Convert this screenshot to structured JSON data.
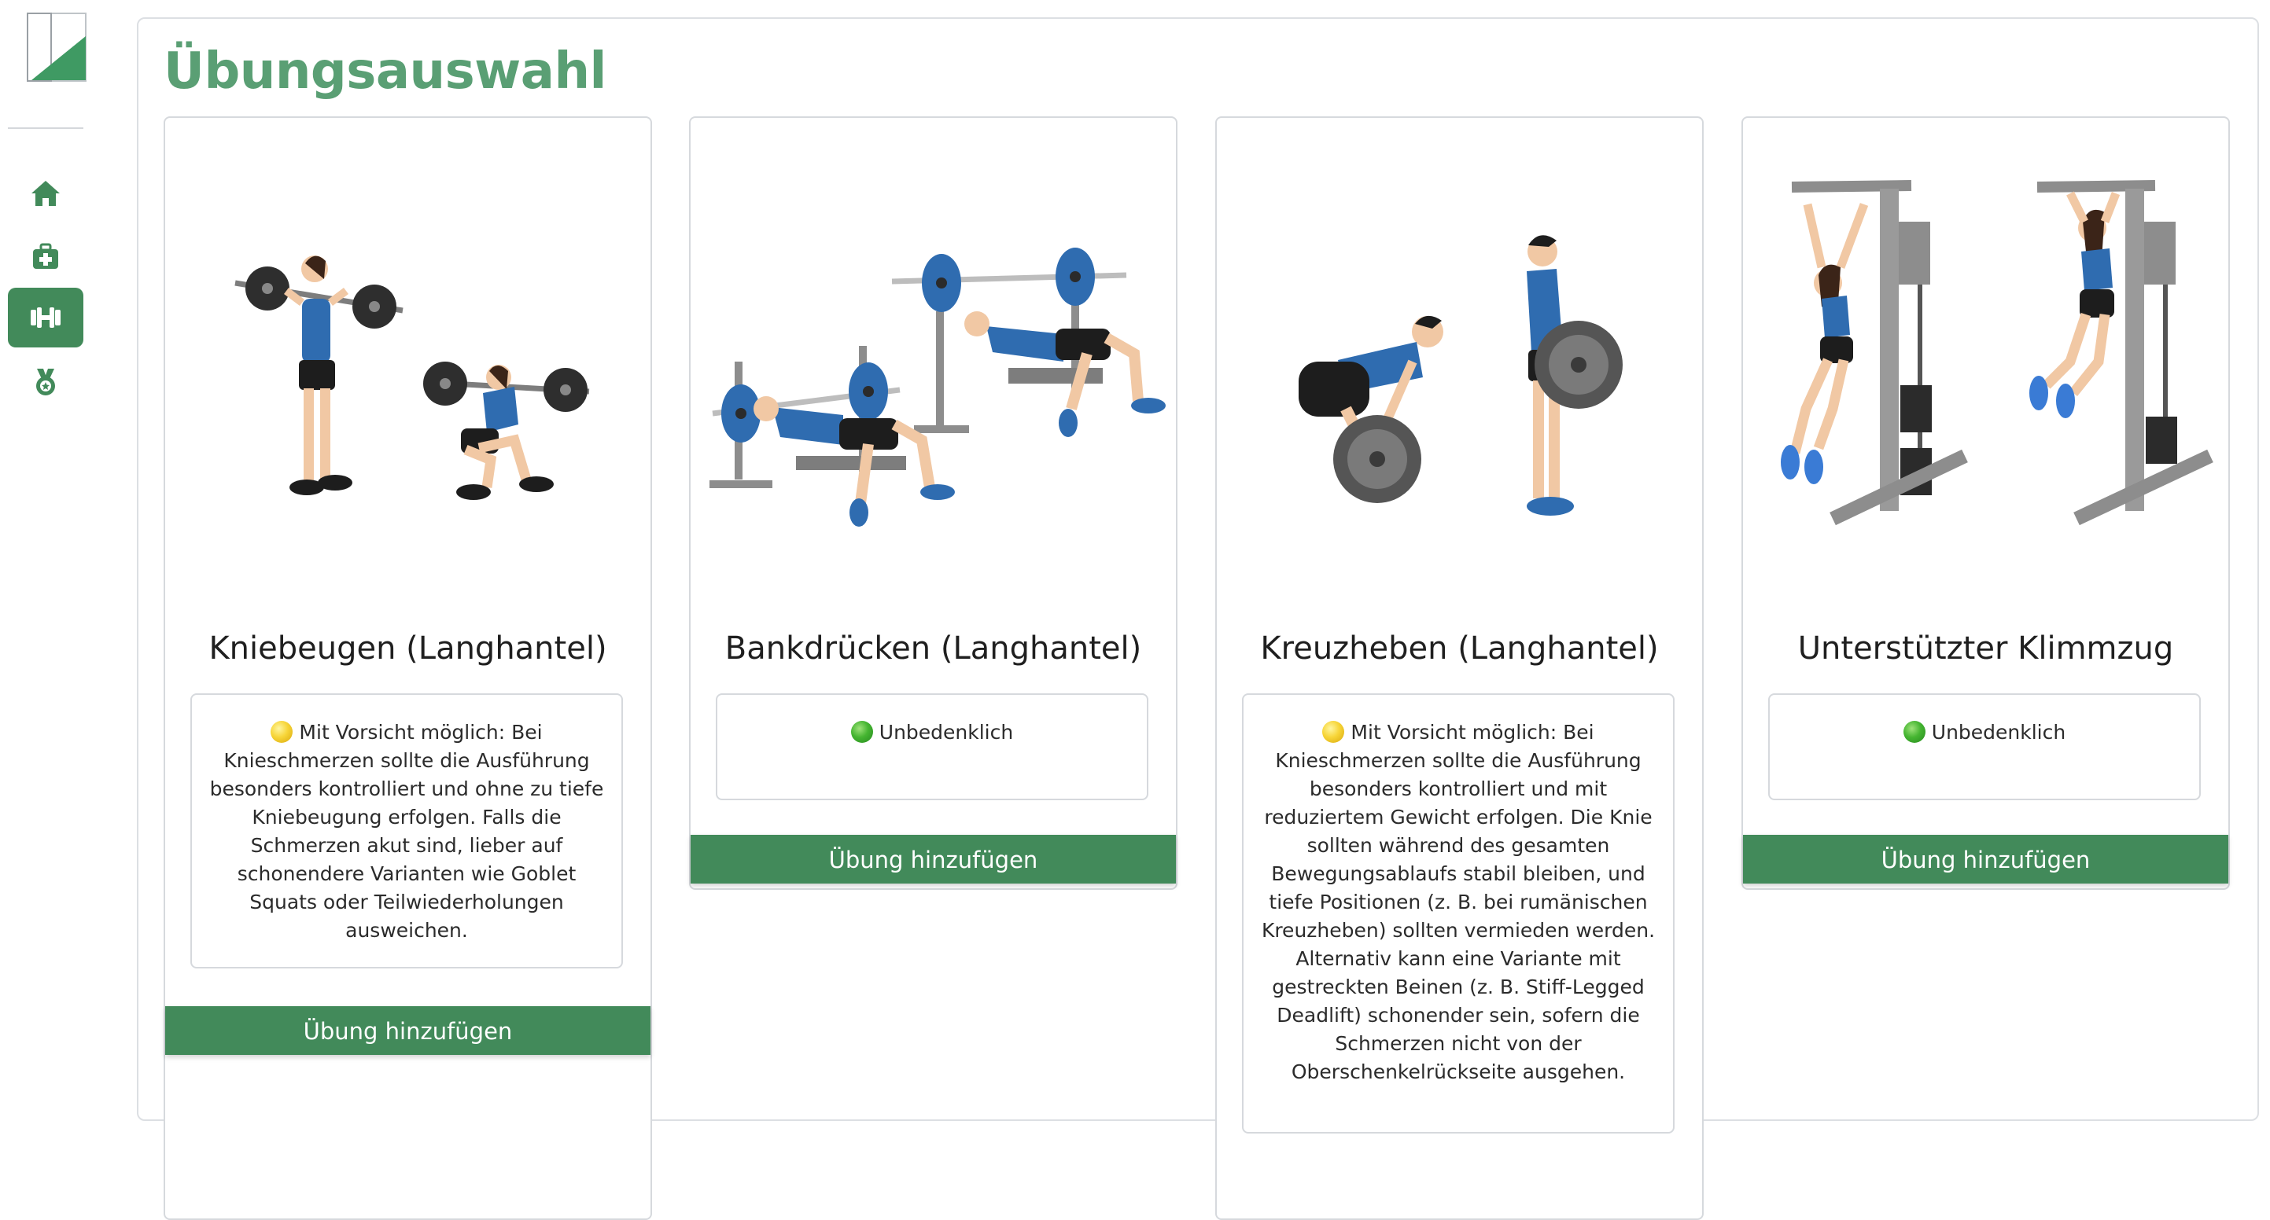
{
  "sidebar": {
    "items": [
      {
        "icon": "home-icon",
        "active": false
      },
      {
        "icon": "medical-bag-icon",
        "active": false
      },
      {
        "icon": "dumbbell-icon",
        "active": true
      },
      {
        "icon": "medal-icon",
        "active": false
      }
    ]
  },
  "page": {
    "title": "Übungsauswahl"
  },
  "colors": {
    "accent": "#428a5a",
    "title": "#5a9f74",
    "yellow_status": "#f7d538",
    "green_status": "#45b531"
  },
  "cards": [
    {
      "title": "Kniebeugen (Langhantel)",
      "status": "yellow",
      "note": "Mit Vorsicht möglich: Bei Knieschmerzen sollte die Ausführung besonders kontrolliert und ohne zu tiefe Kniebeugung erfolgen. Falls die Schmerzen akut sind, lieber auf schonendere Varianten wie Goblet Squats oder Teilwiederholungen ausweichen.",
      "button": "Übung hinzufügen"
    },
    {
      "title": "Bankdrücken (Langhantel)",
      "status": "green",
      "note": "Unbedenklich",
      "button": "Übung hinzufügen"
    },
    {
      "title": "Kreuzheben (Langhantel)",
      "status": "yellow",
      "note": "Mit Vorsicht möglich: Bei Knieschmerzen sollte die Ausführung besonders kontrolliert und mit reduziertem Gewicht erfolgen. Die Knie sollten während des gesamten Bewegungsablaufs stabil bleiben, und tiefe Positionen (z. B. bei rumänischen Kreuzheben) sollten vermieden werden. Alternativ kann eine Variante mit gestreckten Beinen (z. B. Stiff-Legged Deadlift) schonender sein, sofern die Schmerzen nicht von der Oberschenkelrückseite ausgehen.",
      "button": "Übung hinzufügen"
    },
    {
      "title": "Unterstützter Klimmzug",
      "status": "green",
      "note": "Unbedenklich",
      "button": "Übung hinzufügen"
    }
  ]
}
